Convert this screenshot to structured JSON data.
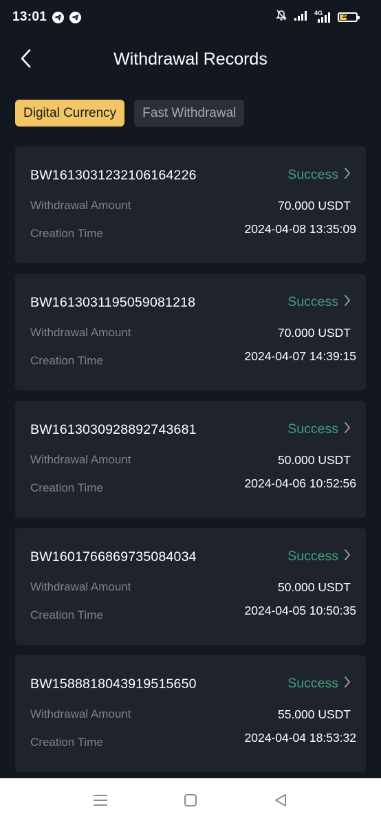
{
  "status_bar": {
    "time": "13:01",
    "network": "4G",
    "battery": "32%",
    "icons": [
      "telegram-icon",
      "telegram-icon",
      "mute-icon",
      "signal-icon",
      "signal-icon",
      "battery-icon"
    ]
  },
  "header": {
    "title": "Withdrawal Records",
    "back_icon": "chevron-left-icon"
  },
  "tabs": [
    {
      "label": "Digital Currency",
      "active": true
    },
    {
      "label": "Fast Withdrawal",
      "active": false
    }
  ],
  "labels": {
    "amount": "Withdrawal Amount",
    "time": "Creation Time"
  },
  "records": [
    {
      "id": "BW1613031232106164226",
      "status": "Success",
      "amount": "70.000 USDT",
      "time": "2024-04-08 13:35:09"
    },
    {
      "id": "BW1613031195059081218",
      "status": "Success",
      "amount": "70.000 USDT",
      "time": "2024-04-07 14:39:15"
    },
    {
      "id": "BW1613030928892743681",
      "status": "Success",
      "amount": "50.000 USDT",
      "time": "2024-04-06 10:52:56"
    },
    {
      "id": "BW1601766869735084034",
      "status": "Success",
      "amount": "50.000 USDT",
      "time": "2024-04-05 10:50:35"
    },
    {
      "id": "BW1588818043919515650",
      "status": "Success",
      "amount": "55.000 USDT",
      "time": "2024-04-04 18:53:32"
    }
  ],
  "colors": {
    "background": "#13171f",
    "card": "#1e232c",
    "accent": "#f2c665",
    "success": "#3fa37a",
    "muted_text": "#7d838d"
  },
  "nav_bar": {
    "icons": [
      "menu-icon",
      "home-square-icon",
      "back-triangle-icon"
    ]
  }
}
